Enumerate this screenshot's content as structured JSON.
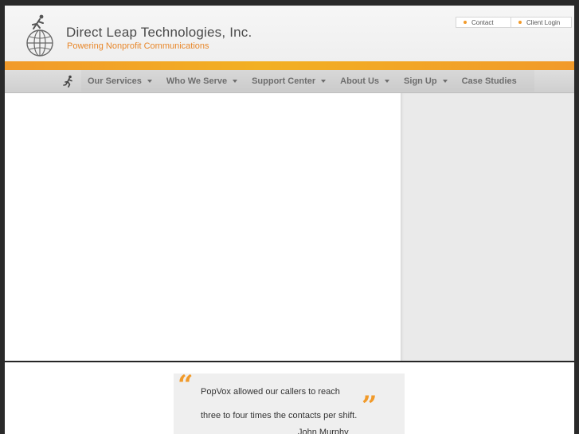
{
  "brand": {
    "name": "Direct Leap Technologies, Inc.",
    "tagline": "Powering Nonprofit Communications"
  },
  "top_links": {
    "contact": "Contact",
    "client_login": "Client Login"
  },
  "nav": {
    "items": [
      {
        "label": "Our Services",
        "has_dropdown": true
      },
      {
        "label": "Who We Serve",
        "has_dropdown": true
      },
      {
        "label": "Support Center",
        "has_dropdown": true
      },
      {
        "label": "About Us",
        "has_dropdown": true
      },
      {
        "label": "Sign Up",
        "has_dropdown": true
      },
      {
        "label": "Case Studies",
        "has_dropdown": false
      }
    ]
  },
  "testimonial": {
    "line1": "PopVox allowed our callers to reach",
    "line2": "three to four times the contacts per shift.",
    "author": "John Murphy"
  },
  "colors": {
    "accent_orange": "#f19a2a",
    "nav_text": "#6d6d6d",
    "brand_text": "#4a4a4a"
  },
  "icons": [
    "globe-runner-logo-icon",
    "runner-home-icon",
    "chevron-down-icon",
    "open-quote-icon",
    "close-quote-icon"
  ]
}
